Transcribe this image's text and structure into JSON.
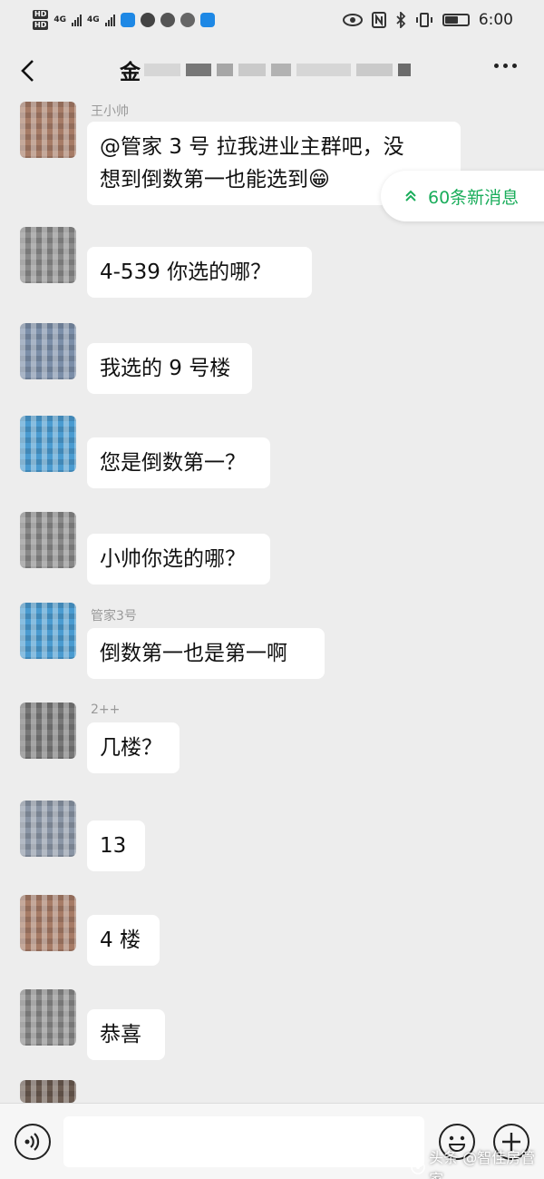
{
  "status_bar": {
    "network_left_top": "4G",
    "network_left_bottom": "4G",
    "time": "6:00"
  },
  "header": {
    "title": "金",
    "more_icon": "more-dots-icon",
    "back_icon": "back-chevron-icon"
  },
  "new_messages_pill": {
    "label": "60条新消息",
    "icon": "double-chevron-up-icon",
    "color": "#1aad5b"
  },
  "messages": [
    {
      "sender": "王小帅",
      "text_line1": "@管家 3 号  拉我进业主群吧，没",
      "text_line2": "想到倒数第一也能选到😁"
    },
    {
      "sender": "",
      "text": "4-539  你选的哪？"
    },
    {
      "sender": "",
      "text": "我选的 9 号楼"
    },
    {
      "sender": "",
      "text": "您是倒数第一？"
    },
    {
      "sender": "",
      "text": "小帅你选的哪？"
    },
    {
      "sender": "管家3号",
      "text": "倒数第一也是第一啊"
    },
    {
      "sender": "2++",
      "text": "几楼？"
    },
    {
      "sender": "",
      "text": "13"
    },
    {
      "sender": "",
      "text": "4 楼"
    },
    {
      "sender": "",
      "text": "恭喜"
    }
  ],
  "input_bar": {
    "voice_icon": "voice-icon",
    "emoji_icon": "emoji-icon",
    "plus_icon": "plus-icon"
  },
  "watermark": "头条 @智佳房管家"
}
